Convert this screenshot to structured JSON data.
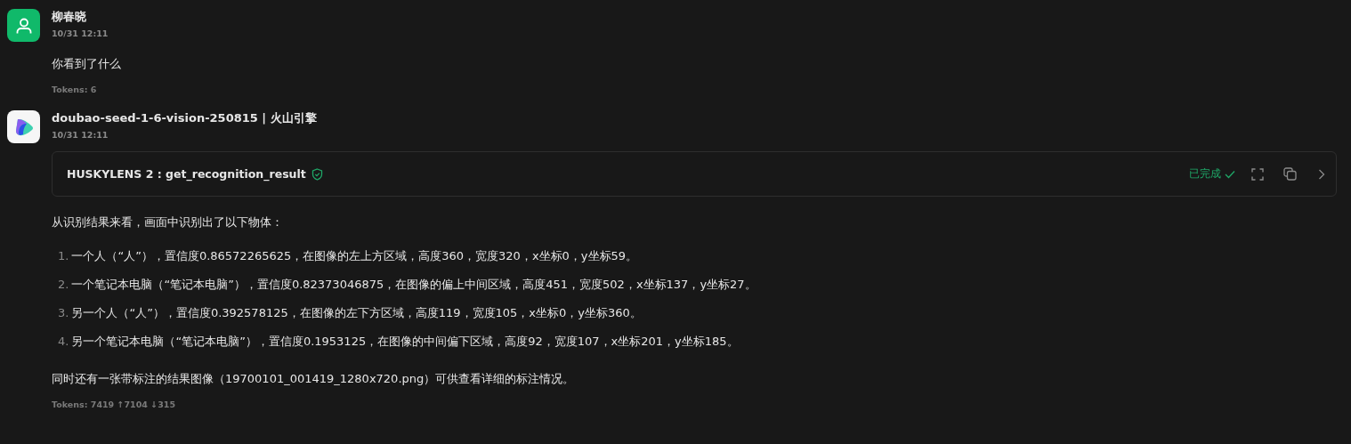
{
  "messages": [
    {
      "kind": "user",
      "author": "柳春晓",
      "time": "10/31 12:11",
      "blocks": [
        {
          "kind": "paragraph",
          "text": "你看到了什么"
        }
      ],
      "tokens": "Tokens: 6"
    },
    {
      "kind": "assistant",
      "author": "doubao-seed-1-6-vision-250815 | 火山引擎",
      "time": "10/31 12:11",
      "blocks": [
        {
          "kind": "tool_call",
          "title": "HUSKYLENS 2 : get_recognition_result",
          "status": "已完成"
        },
        {
          "kind": "paragraph",
          "text": "从识别结果来看，画面中识别出了以下物体："
        },
        {
          "kind": "list",
          "items": [
            {
              "number": "1.",
              "text": "一个人（“人”），置信度0.86572265625，在图像的左上方区域，高度360，宽度320，x坐标0，y坐标59。"
            },
            {
              "number": "2.",
              "text": "一个笔记本电脑（“笔记本电脑”），置信度0.82373046875，在图像的偏上中间区域，高度451，宽度502，x坐标137，y坐标27。"
            },
            {
              "number": "3.",
              "text": "另一个人（“人”），置信度0.392578125，在图像的左下方区域，高度119，宽度105，x坐标0，y坐标360。"
            },
            {
              "number": "4.",
              "text": "另一个笔记本电脑（“笔记本电脑”），置信度0.1953125，在图像的中间偏下区域，高度92，宽度107，x坐标201，y坐标185。"
            }
          ]
        },
        {
          "kind": "paragraph",
          "text": "同时还有一张带标注的结果图像（19700101_001419_1280x720.png）可供查看详细的标注情况。"
        }
      ],
      "tokens": "Tokens: 7419 ↑7104 ↓315"
    }
  ]
}
